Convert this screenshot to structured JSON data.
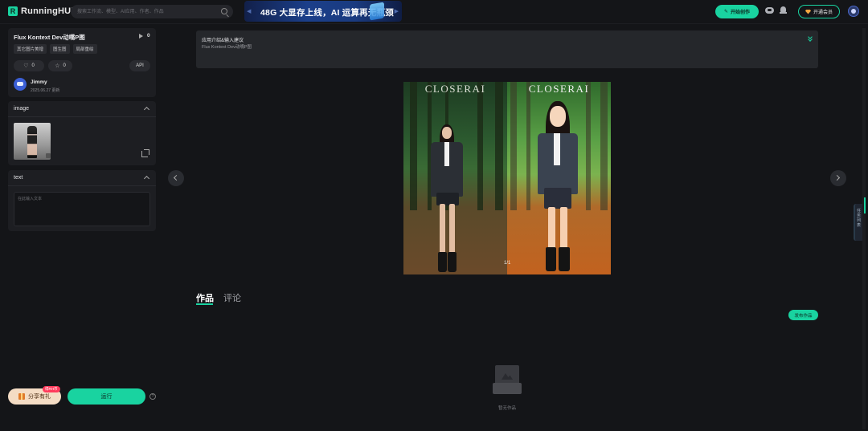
{
  "header": {
    "logo_mark": "R",
    "logo_text": "RunningHUB",
    "search_placeholder": "搜索工作流、模型、AI应用、作者、作品",
    "banner_text": "48G 大显存上线，AI 运算再无瓶颈",
    "create_label": "开始创作",
    "member_label": "开通会员"
  },
  "workflow": {
    "title": "Flux Kontext Dev动嘴P图",
    "play_count": "0",
    "tags": [
      "其它图片美增",
      "图生图",
      "局部重绘"
    ],
    "likes": "0",
    "favorites": "0",
    "api_label": "API",
    "author": "Jimmy",
    "updated": "2025.06.27 更新"
  },
  "inputs": {
    "image_label": "image",
    "text_label": "text",
    "text_placeholder": "在此输入文本"
  },
  "bottom": {
    "share_label": "分享有礼",
    "share_badge": "得RH币",
    "run_label": "运行",
    "help_glyph": "?"
  },
  "intro": {
    "title": "应用介绍&输入建议",
    "desc": "Flux Kontext Dev动嘴P图"
  },
  "preview": {
    "brand_left": "CLOSERAI",
    "brand_right": "CLOSERAI",
    "counter": "1/1"
  },
  "tabs": {
    "works": "作品",
    "comments": "评论"
  },
  "publish_label": "发布作品",
  "empty_text": "暂无作品",
  "side_tab_text": "任务列表",
  "colors": {
    "accent": "#19d3a0",
    "background": "#141518",
    "panel": "#1d1e22"
  }
}
